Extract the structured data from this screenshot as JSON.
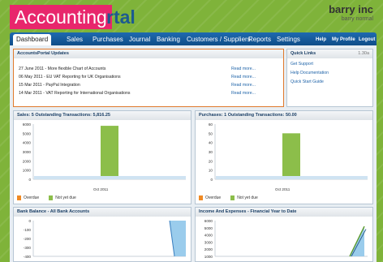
{
  "header": {
    "logo_badge": "Accounting",
    "logo_rest": "rtal",
    "company_name": "barry inc",
    "company_user": "barry normal"
  },
  "nav": {
    "items": [
      "Dashboard",
      "Sales",
      "Purchases",
      "Journal",
      "Banking",
      "Customers / Suppliers",
      "Reports",
      "Settings"
    ],
    "right_items": [
      "Help",
      "My Profile",
      "Logout"
    ]
  },
  "updates": {
    "title": "AccountsPortal Updates",
    "rows": [
      {
        "text": "27 June 2011 - More flexible Chart of Accounts",
        "link": "Read more..."
      },
      {
        "text": "06 May 2011 - EU VAT Reporting for UK Organisations",
        "link": "Read more..."
      },
      {
        "text": "15 Mar 2011 - PayPal Integration",
        "link": "Read more..."
      },
      {
        "text": "14 Mar 2011 - VAT Reporting for International Organisations",
        "link": "Read more..."
      }
    ]
  },
  "quick_links": {
    "title": "Quick Links",
    "version": "1.30a",
    "links": [
      "Get Support",
      "Help Documentation",
      "Quick Start Guide"
    ]
  },
  "colors": {
    "overdue": "#f08a24",
    "not_yet_due": "#8cbe4a",
    "bank_fill": "#8fc6ea",
    "bank_line": "#3a7fc0"
  },
  "legend": {
    "overdue": "Overdue",
    "not_yet_due": "Not yet due"
  },
  "chart_data": [
    {
      "type": "bar",
      "title": "Sales: 5 Outstanding Transactions: 5,816.25",
      "categories": [
        "Oct 2011"
      ],
      "series": [
        {
          "name": "Overdue",
          "values": [
            0
          ]
        },
        {
          "name": "Not yet due",
          "values": [
            5816.25
          ]
        }
      ],
      "yticks": [
        "6000",
        "5000",
        "4000",
        "3000",
        "2000",
        "1000",
        "0"
      ],
      "ylim": [
        0,
        6000
      ]
    },
    {
      "type": "bar",
      "title": "Purchases: 1 Outstanding Transactions: 50.00",
      "categories": [
        "Oct 2011"
      ],
      "series": [
        {
          "name": "Overdue",
          "values": [
            0
          ]
        },
        {
          "name": "Not yet due",
          "values": [
            50
          ]
        }
      ],
      "yticks": [
        "60",
        "50",
        "40",
        "30",
        "20",
        "10",
        "0"
      ],
      "ylim": [
        0,
        60
      ]
    },
    {
      "type": "area",
      "title": "Bank Balance - All Bank Accounts",
      "yticks": [
        "0",
        "-100",
        "-200",
        "-300",
        "-400"
      ],
      "ylim": [
        -400,
        0
      ]
    },
    {
      "type": "area",
      "title": "Income And Expenses - Financial Year to Date",
      "yticks": [
        "6000",
        "5000",
        "4000",
        "3000",
        "2000",
        "1000"
      ],
      "ylim": [
        1000,
        6000
      ]
    }
  ]
}
